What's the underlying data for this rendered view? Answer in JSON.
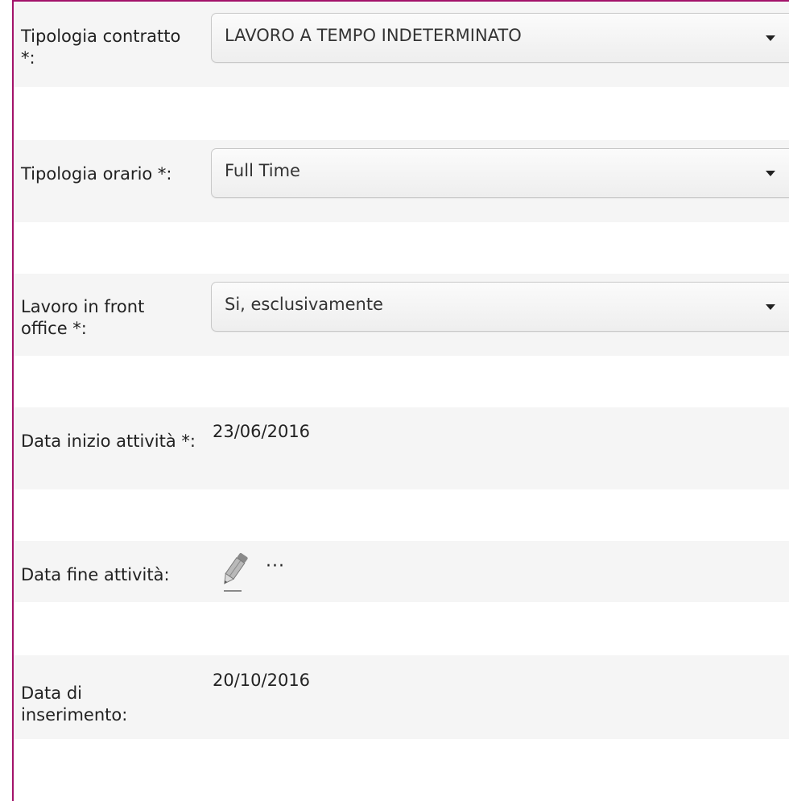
{
  "form": {
    "contract_type": {
      "label": "Tipologia contratto *:",
      "selected": "LAVORO A TEMPO INDETERMINATO"
    },
    "schedule_type": {
      "label": "Tipologia orario *:",
      "selected": "Full Time"
    },
    "front_office": {
      "label": "Lavoro in front office *:",
      "selected": "Si, esclusivamente"
    },
    "start_date": {
      "label": "Data inizio attività *:",
      "value": "23/06/2016"
    },
    "end_date": {
      "label": "Data fine attività:",
      "more_text": "···",
      "edit_icon": "pencil-icon"
    },
    "insertion_date": {
      "label": "Data di inserimento:",
      "value": "20/10/2016"
    }
  },
  "colors": {
    "frame_border": "#a3126a",
    "row_background": "#f5f5f5"
  }
}
